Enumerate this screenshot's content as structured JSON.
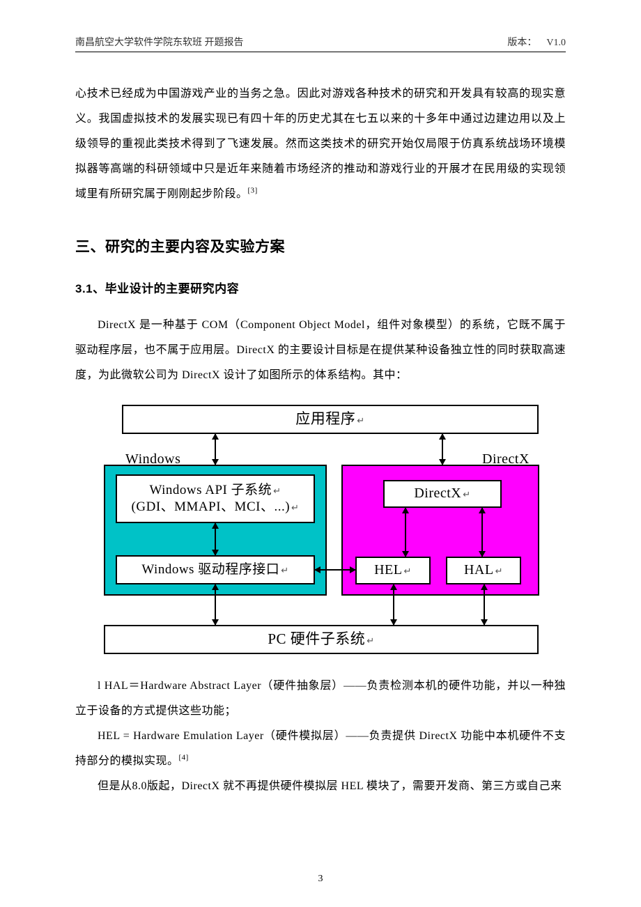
{
  "header": {
    "left": "南昌航空大学软件学院东软班  开题报告",
    "right_prefix": "版本：",
    "version": "V1.0"
  },
  "continuation_para": "心技术已经成为中国游戏产业的当务之急。因此对游戏各种技术的研究和开发具有较高的现实意义。我国虚拟技术的发展实现已有四十年的历史尤其在七五以来的十多年中通过边建边用以及上级领导的重视此类技术得到了飞速发展。然而这类技术的研究开始仅局限于仿真系统战场环境模拟器等高端的科研领域中只是近年来随着市场经济的推动和游戏行业的开展才在民用级的实现领域里有所研究属于刚刚起步阶段。",
  "continuation_citation": "[3]",
  "section3_title": "三、研究的主要内容及实验方案",
  "section31_title": "3.1、毕业设计的主要研究内容",
  "para31": "DirectX 是一种基于 COM（Component Object Model，组件对象模型）的系统，它既不属于驱动程序层，也不属于应用层。DirectX 的主要设计目标是在提供某种设备独立性的同时获取高速度，为此微软公司为 DirectX 设计了如图所示的体系结构。其中：",
  "diagram": {
    "app": "应用程序",
    "win_label": "Windows",
    "dx_label": "DirectX",
    "win_api_l1": "Windows API 子系统",
    "win_api_l2": "(GDI、MMAPI、MCI、...)",
    "win_drv": "Windows 驱动程序接口",
    "dx_box": "DirectX",
    "hel": "HEL",
    "hal": "HAL",
    "pc": "PC 硬件子系统"
  },
  "para_hal": "l HAL＝Hardware Abstract Layer（硬件抽象层）——负责检测本机的硬件功能，并以一种独立于设备的方式提供这些功能；",
  "para_hel": "HEL = Hardware Emulation Layer（硬件模拟层）——负责提供 DirectX 功能中本机硬件不支持部分的模拟实现。",
  "hel_citation": "[4]",
  "para_v8": "但是从8.0版起，DirectX 就不再提供硬件模拟层 HEL 模块了，需要开发商、第三方或自己来",
  "page_number": "3",
  "return_mark": "↵"
}
